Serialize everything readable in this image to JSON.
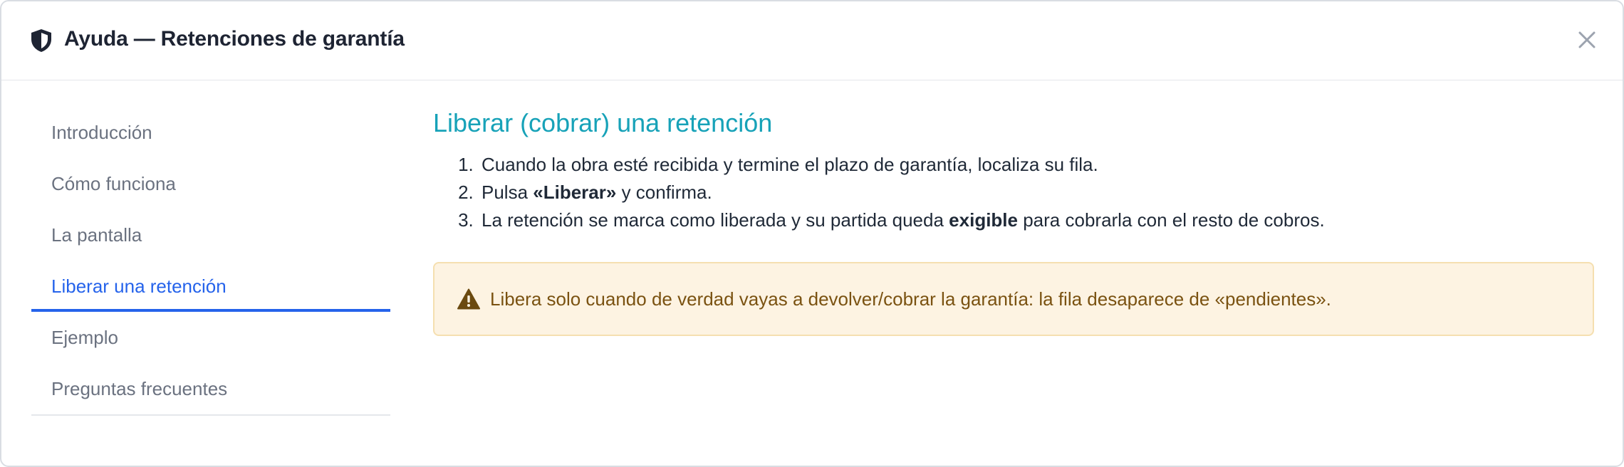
{
  "dialog": {
    "title": "Ayuda — Retenciones de garantía",
    "icon": "shield-icon",
    "close_icon": "close-icon",
    "close_symbol": "×"
  },
  "sidebar": {
    "items": [
      {
        "label": "Introducción",
        "active": false
      },
      {
        "label": "Cómo funciona",
        "active": false
      },
      {
        "label": "La pantalla",
        "active": false
      },
      {
        "label": "Liberar una retención",
        "active": true
      },
      {
        "label": "Ejemplo",
        "active": false
      },
      {
        "label": "Preguntas frecuentes",
        "active": false
      }
    ]
  },
  "section": {
    "heading": "Liberar (cobrar) una retención",
    "steps": [
      {
        "parts": [
          "Cuando la obra esté recibida y termine el plazo de garantía, localiza su fila."
        ]
      },
      {
        "pre": "Pulsa ",
        "bold": "«Liberar»",
        "post": " y confirma."
      },
      {
        "pre": "La retención se marca como liberada y su partida queda ",
        "bold": "exigible",
        "post": " para cobrarla con el resto de cobros."
      }
    ],
    "alert": {
      "icon": "warning-icon",
      "text": "Libera solo cuando de verdad vayas a devolver/cobrar la garantía: la fila desaparece de «pendientes»."
    }
  },
  "colors": {
    "accent": "#2563eb",
    "heading": "#17a2b8",
    "alert_bg": "#fdf3e2",
    "alert_text": "#7a5211"
  }
}
